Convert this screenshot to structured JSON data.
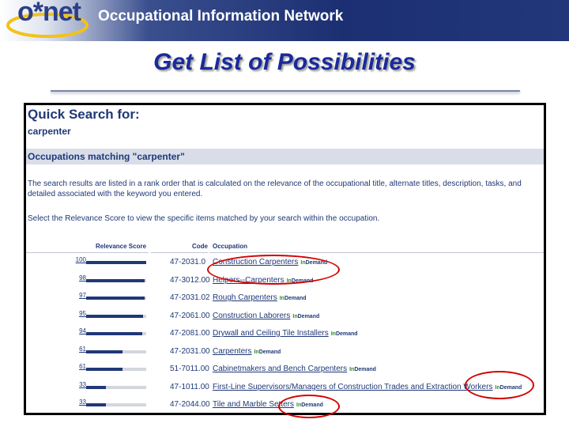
{
  "header": {
    "logo_text": "o*net",
    "title": "Occupational Information Network"
  },
  "slide_title": "Get List of Possibilities",
  "screenshot": {
    "quick_search_label": "Quick Search for:",
    "search_term": "carpenter",
    "occupations_heading": "Occupations matching \"carpenter\"",
    "description": "The search results are listed in a rank order that is calculated on the relevance of the occupational title, alternate titles, description, tasks, and detailed associated with the keyword you entered.",
    "select_text": "Select the Relevance Score to view the specific items matched by your search within the occupation.",
    "columns": {
      "relevance": "Relevance Score",
      "code": "Code",
      "occupation": "Occupation"
    },
    "in_demand_label": {
      "in": "In",
      "demand": "Demand"
    },
    "rows": [
      {
        "score": "100",
        "score_value": 100,
        "code": "47-2031.0",
        "occupation": "Construction Carpenters",
        "in_demand": true
      },
      {
        "score": "98",
        "score_value": 98,
        "code": "47-3012.00",
        "occupation": "Helpers--Carpenters",
        "in_demand": true
      },
      {
        "score": "97",
        "score_value": 97,
        "code": "47-2031.02",
        "occupation": "Rough Carpenters",
        "in_demand": true
      },
      {
        "score": "95",
        "score_value": 95,
        "code": "47-2061.00",
        "occupation": "Construction Laborers",
        "in_demand": true
      },
      {
        "score": "94",
        "score_value": 94,
        "code": "47-2081.00",
        "occupation": "Drywall and Ceiling Tile Installers",
        "in_demand": true
      },
      {
        "score": "61",
        "score_value": 61,
        "code": "47-2031.00",
        "occupation": "Carpenters",
        "in_demand": true
      },
      {
        "score": "61",
        "score_value": 61,
        "code": "51-7011.00",
        "occupation": "Cabinetmakers and Bench Carpenters",
        "in_demand": true
      },
      {
        "score": "33",
        "score_value": 33,
        "code": "47-1011.00",
        "occupation": "First-Line Supervisors/Managers of Construction Trades and Extraction Workers",
        "in_demand": true
      },
      {
        "score": "33",
        "score_value": 33,
        "code": "47-2044.00",
        "occupation": "Tile and Marble Setters",
        "in_demand": true
      }
    ]
  },
  "colors": {
    "annotation_circle": "#d40000",
    "in_demand_green": "#2d8a2d",
    "onet_navy": "#1f3877"
  }
}
